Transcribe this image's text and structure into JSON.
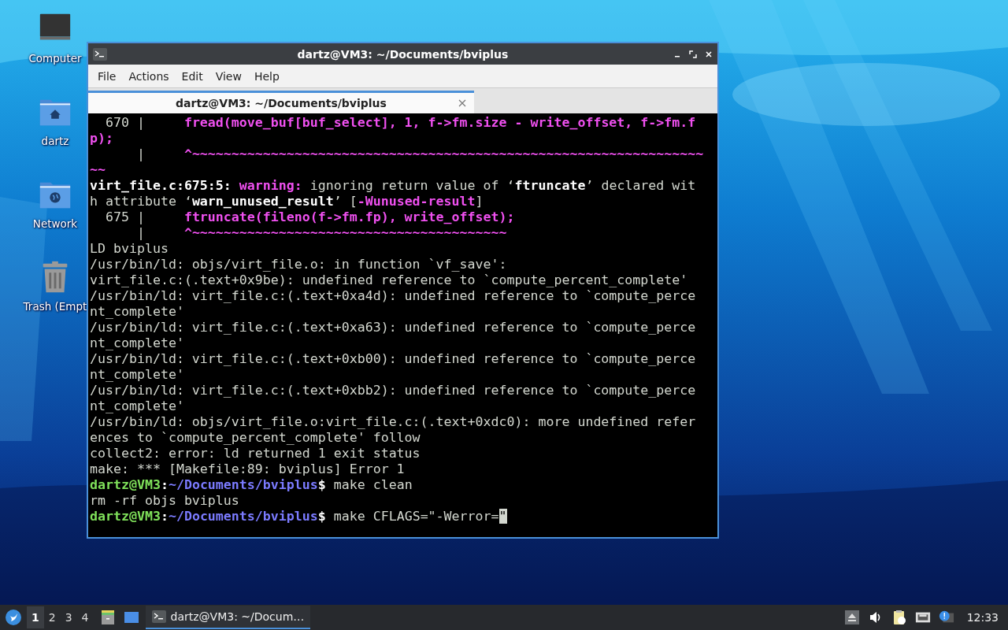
{
  "desktop_icons": [
    {
      "label": "Computer",
      "kind": "computer"
    },
    {
      "label": "dartz",
      "kind": "home"
    },
    {
      "label": "Network",
      "kind": "network"
    },
    {
      "label": "Trash (Empt",
      "kind": "trash"
    }
  ],
  "window": {
    "title": "dartz@VM3: ~/Documents/bviplus",
    "menu": [
      "File",
      "Actions",
      "Edit",
      "View",
      "Help"
    ],
    "tabs": [
      {
        "label": "dartz@VM3: ~/Documents/bviplus",
        "selected": true
      }
    ],
    "terminal": {
      "lines": [
        [
          {
            "text": "  670 |     ",
            "kind": "normal"
          },
          {
            "text": "fread(move_buf[buf_select], 1, f->fm.size - write_offset, f->fm.f",
            "kind": "magenta"
          }
        ],
        [
          {
            "text": "p);",
            "kind": "magenta"
          }
        ],
        [
          {
            "text": "      |     ",
            "kind": "normal"
          },
          {
            "text": "^~~~~~~~~~~~~~~~~~~~~~~~~~~~~~~~~~~~~~~~~~~~~~~~~~~~~~~~~~~~~~~~~~",
            "kind": "magenta"
          }
        ],
        [
          {
            "text": "~~",
            "kind": "magenta"
          }
        ],
        [
          {
            "text": "virt_file.c:675:5: ",
            "kind": "bold"
          },
          {
            "text": "warning:",
            "kind": "magenta"
          },
          {
            "text": " ignoring return value of ‘",
            "kind": "normal"
          },
          {
            "text": "ftruncate",
            "kind": "bold"
          },
          {
            "text": "’ declared wit",
            "kind": "normal"
          }
        ],
        [
          {
            "text": "h attribute ‘",
            "kind": "normal"
          },
          {
            "text": "warn_unused_result",
            "kind": "bold"
          },
          {
            "text": "’ [",
            "kind": "normal"
          },
          {
            "text": "-Wunused-result",
            "kind": "magenta"
          },
          {
            "text": "]",
            "kind": "normal"
          }
        ],
        [
          {
            "text": "  675 |     ",
            "kind": "normal"
          },
          {
            "text": "ftruncate(fileno(f->fm.fp), write_offset);",
            "kind": "magenta"
          }
        ],
        [
          {
            "text": "      |     ",
            "kind": "normal"
          },
          {
            "text": "^~~~~~~~~~~~~~~~~~~~~~~~~~~~~~~~~~~~~~~~~",
            "kind": "magenta"
          }
        ],
        [
          {
            "text": "LD bviplus",
            "kind": "normal"
          }
        ],
        [
          {
            "text": "/usr/bin/ld: objs/virt_file.o: in function `vf_save':",
            "kind": "normal"
          }
        ],
        [
          {
            "text": "virt_file.c:(.text+0x9be): undefined reference to `compute_percent_complete'",
            "kind": "normal"
          }
        ],
        [
          {
            "text": "/usr/bin/ld: virt_file.c:(.text+0xa4d): undefined reference to `compute_perce",
            "kind": "normal"
          }
        ],
        [
          {
            "text": "nt_complete'",
            "kind": "normal"
          }
        ],
        [
          {
            "text": "/usr/bin/ld: virt_file.c:(.text+0xa63): undefined reference to `compute_perce",
            "kind": "normal"
          }
        ],
        [
          {
            "text": "nt_complete'",
            "kind": "normal"
          }
        ],
        [
          {
            "text": "/usr/bin/ld: virt_file.c:(.text+0xb00): undefined reference to `compute_perce",
            "kind": "normal"
          }
        ],
        [
          {
            "text": "nt_complete'",
            "kind": "normal"
          }
        ],
        [
          {
            "text": "/usr/bin/ld: virt_file.c:(.text+0xbb2): undefined reference to `compute_perce",
            "kind": "normal"
          }
        ],
        [
          {
            "text": "nt_complete'",
            "kind": "normal"
          }
        ],
        [
          {
            "text": "/usr/bin/ld: objs/virt_file.o:virt_file.c:(.text+0xdc0): more undefined refer",
            "kind": "normal"
          }
        ],
        [
          {
            "text": "ences to `compute_percent_complete' follow",
            "kind": "normal"
          }
        ],
        [
          {
            "text": "collect2: error: ld returned 1 exit status",
            "kind": "normal"
          }
        ],
        [
          {
            "text": "make: *** [Makefile:89: bviplus] Error 1",
            "kind": "normal"
          }
        ],
        [
          {
            "text": "dartz@VM3",
            "kind": "green"
          },
          {
            "text": ":",
            "kind": "bold"
          },
          {
            "text": "~/Documents/bviplus",
            "kind": "blue"
          },
          {
            "text": "$",
            "kind": "bold"
          },
          {
            "text": " make clean",
            "kind": "normal"
          }
        ],
        [
          {
            "text": "rm -rf objs bviplus",
            "kind": "normal"
          }
        ],
        [
          {
            "text": "dartz@VM3",
            "kind": "green"
          },
          {
            "text": ":",
            "kind": "bold"
          },
          {
            "text": "~/Documents/bviplus",
            "kind": "blue"
          },
          {
            "text": "$",
            "kind": "bold"
          },
          {
            "text": " make CFLAGS=\"-Werror=",
            "kind": "normal"
          },
          {
            "text": "\"",
            "kind": "cursor"
          }
        ]
      ]
    }
  },
  "taskbar": {
    "workspaces": [
      {
        "label": "1",
        "selected": true
      },
      {
        "label": "2",
        "selected": false
      },
      {
        "label": "3",
        "selected": false
      },
      {
        "label": "4",
        "selected": false
      }
    ],
    "tasks": [
      {
        "label": "dartz@VM3: ~/Docum…",
        "selected": true
      }
    ],
    "clock": "12:33"
  }
}
